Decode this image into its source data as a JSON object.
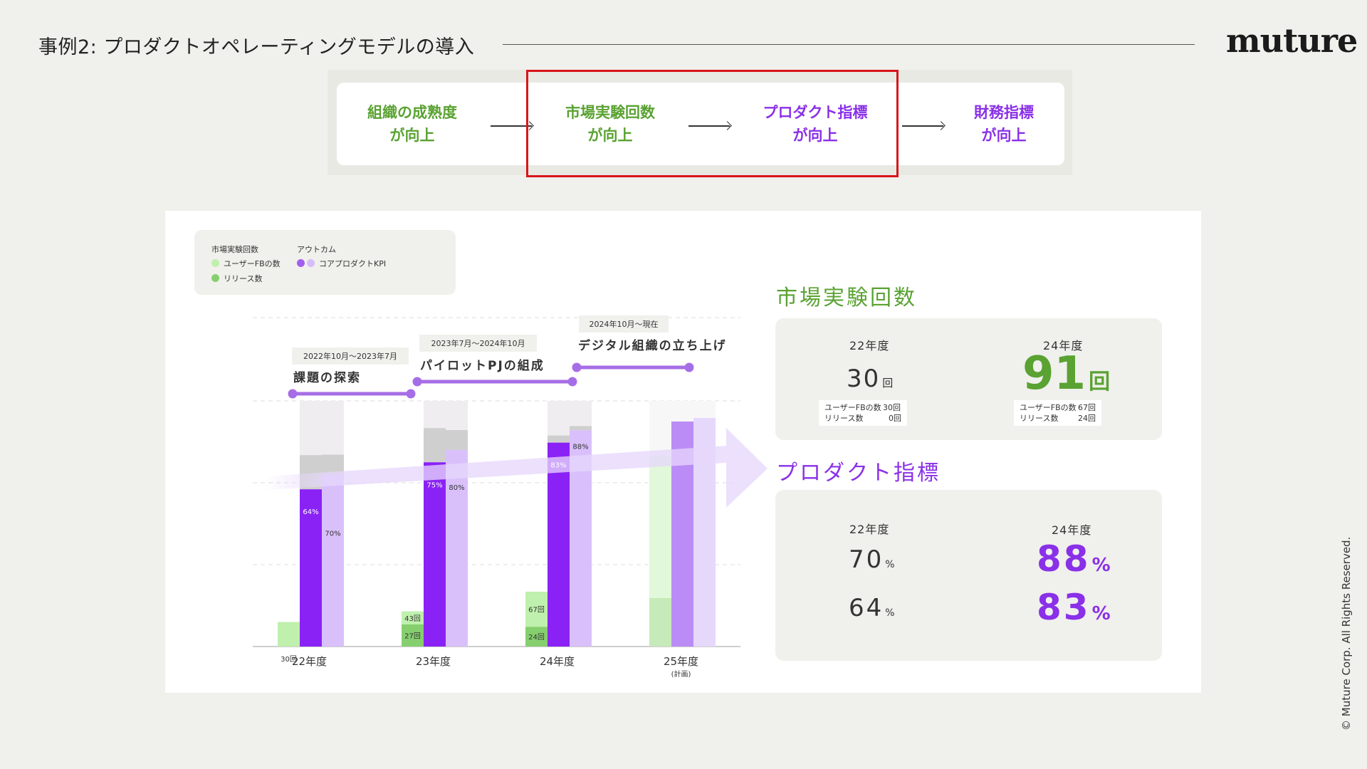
{
  "header": {
    "title": "事例2: プロダクトオペレーティングモデルの導入",
    "logo": "muture",
    "copyright": "© Muture Corp. All Rights Reserved."
  },
  "flow": [
    {
      "line1": "組織の成熟度",
      "line2": "が向上",
      "color": "green"
    },
    {
      "line1": "市場実験回数",
      "line2": "が向上",
      "color": "green"
    },
    {
      "line1": "プロダクト指標",
      "line2": "が向上",
      "color": "purple"
    },
    {
      "line1": "財務指標",
      "line2": "が向上",
      "color": "purple"
    }
  ],
  "legend": {
    "group1_title": "市場実験回数",
    "group2_title": "アウトカム",
    "userfb": "ユーザーFBの数",
    "release": "リリース数",
    "kpi": "コアプロダクトKPI"
  },
  "colors": {
    "release": "#86cf6f",
    "userfb": "#bff0ad",
    "kpi_dark": "#8a22f5",
    "kpi_light": "#d9c0fb",
    "accent_green": "#5aa232",
    "accent_purple": "#8a30e8",
    "highlight": "#d8151b"
  },
  "chart_data": {
    "type": "bar",
    "categories": [
      "22年度",
      "23年度",
      "24年度",
      "25年度"
    ],
    "category_note": "(計画)",
    "ylim_percent": [
      0,
      100
    ],
    "series": [
      {
        "name": "リリース数",
        "values": [
          0,
          27,
          24,
          null
        ]
      },
      {
        "name": "ユーザーFBの数",
        "values": [
          30,
          43,
          67,
          null
        ]
      },
      {
        "name": "コアプロダクトKPI",
        "values": [
          64,
          75,
          83,
          null
        ]
      },
      {
        "name": "コアプロダクトKPI",
        "values": [
          70,
          80,
          88,
          null
        ]
      }
    ],
    "bar_labels": {
      "count": [
        "30回",
        "43回",
        "67回"
      ],
      "release": [
        "",
        "27回",
        "24回"
      ],
      "kpi_dark": [
        "64%",
        "75%",
        "83%"
      ],
      "kpi_light": [
        "70%",
        "80%",
        "88%"
      ]
    },
    "phases": [
      {
        "period": "2022年10月～2023年7月",
        "label": "課題の探索"
      },
      {
        "period": "2023年7月～2024年10月",
        "label": "パイロットPJの組成"
      },
      {
        "period": "2024年10月～現在",
        "label": "デジタル組織の立ち上げ"
      }
    ]
  },
  "market": {
    "title": "市場実験回数",
    "from_year": "22年度",
    "to_year": "24年度",
    "from_value": "30",
    "to_value": "91",
    "unit": "回",
    "from_note": [
      [
        "ユーザーFBの数",
        "30回"
      ],
      [
        "リリース数",
        "0回"
      ]
    ],
    "to_note": [
      [
        "ユーザーFBの数",
        "67回"
      ],
      [
        "リリース数",
        "24回"
      ]
    ]
  },
  "product": {
    "title": "プロダクト指標",
    "from_year": "22年度",
    "to_year": "24年度",
    "rows": [
      {
        "from": "70",
        "to": "88",
        "unit": "%"
      },
      {
        "from": "64",
        "to": "83",
        "unit": "%"
      }
    ]
  }
}
